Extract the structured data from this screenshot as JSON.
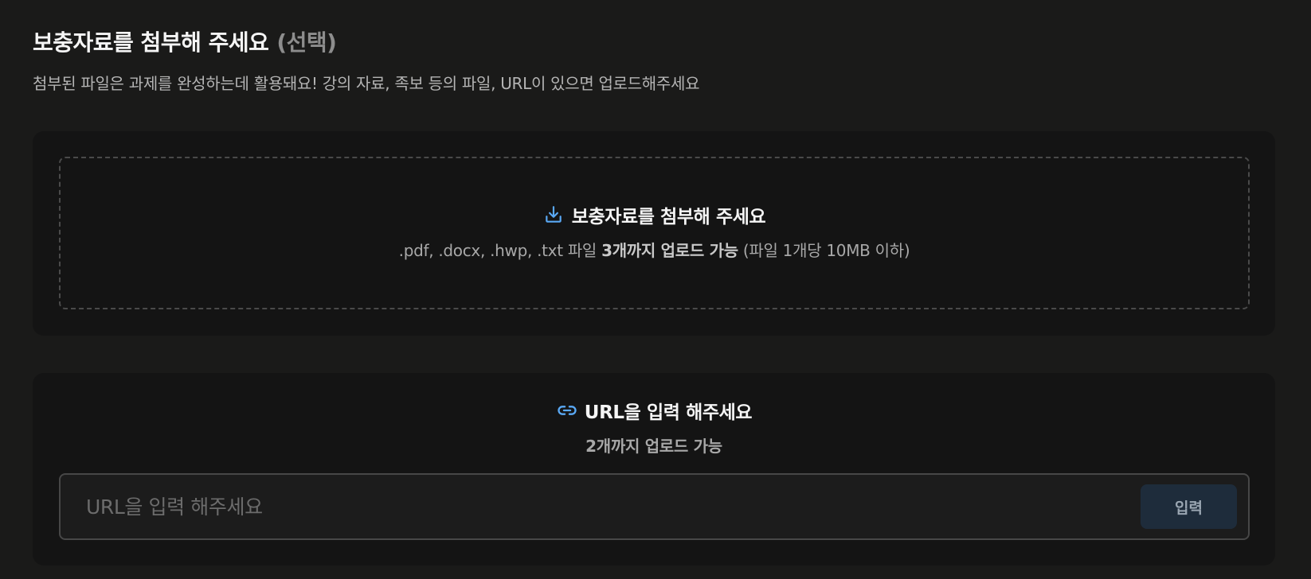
{
  "header": {
    "title": "보충자료를 첨부해 주세요",
    "title_optional": "(선택)",
    "subtitle": "첨부된 파일은 과제를 완성하는데 활용돼요! 강의 자료, 족보 등의 파일, URL이 있으면 업로드해주세요"
  },
  "file_upload": {
    "icon": "download-icon",
    "title": "보충자료를 첨부해 주세요",
    "formats": ".pdf, .docx, .hwp, .txt 파일",
    "limit": "3개까지 업로드 가능",
    "size_note": "(파일 1개당 10MB 이하)"
  },
  "url_upload": {
    "icon": "link-icon",
    "title": "URL을 입력 해주세요",
    "limit": "2개까지 업로드 가능",
    "input_value": "",
    "input_placeholder": "URL을 입력 해주세요",
    "submit_label": "입력"
  },
  "colors": {
    "background": "#1a1a19",
    "card": "#141414",
    "accent_icon": "#5aa9f5",
    "submit_button": "#1e2c3b"
  }
}
